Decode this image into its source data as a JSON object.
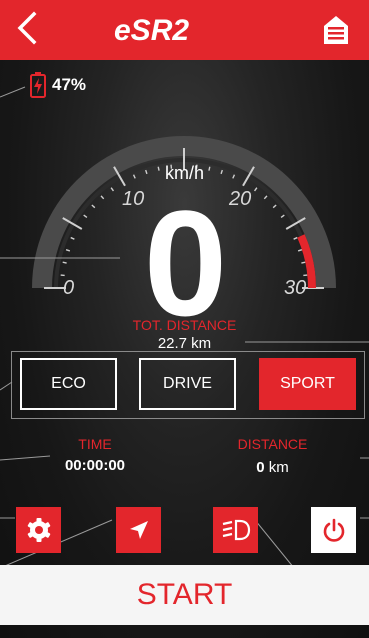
{
  "colors": {
    "accent": "#e3262c",
    "background": "#141414",
    "text": "#ffffff",
    "start_bar": "#f5f5f5"
  },
  "header": {
    "back_icon": "chevron-left-icon",
    "logo_text": "eSR2",
    "menu_icon": "menu-list-icon"
  },
  "battery": {
    "icon": "battery-charging-icon",
    "percent": "47%"
  },
  "speedometer": {
    "unit": "km/h",
    "speed": "0",
    "ticks": [
      "0",
      "10",
      "20",
      "30"
    ],
    "max": 30,
    "red_zone_start": 26
  },
  "total_distance": {
    "label": "TOT. DISTANCE",
    "value": "22.7 km"
  },
  "modes": {
    "items": [
      {
        "label": "ECO",
        "active": false
      },
      {
        "label": "DRIVE",
        "active": false
      },
      {
        "label": "SPORT",
        "active": true
      }
    ]
  },
  "trip": {
    "time_label": "TIME",
    "time_value": "00:00:00",
    "distance_label": "DISTANCE",
    "distance_number": "0",
    "distance_unit": "km"
  },
  "controls": {
    "settings_icon": "gear-icon",
    "navigation_icon": "navigation-arrow-icon",
    "headlight_icon": "headlight-icon",
    "power_icon": "power-icon"
  },
  "start_button": {
    "label": "START"
  }
}
